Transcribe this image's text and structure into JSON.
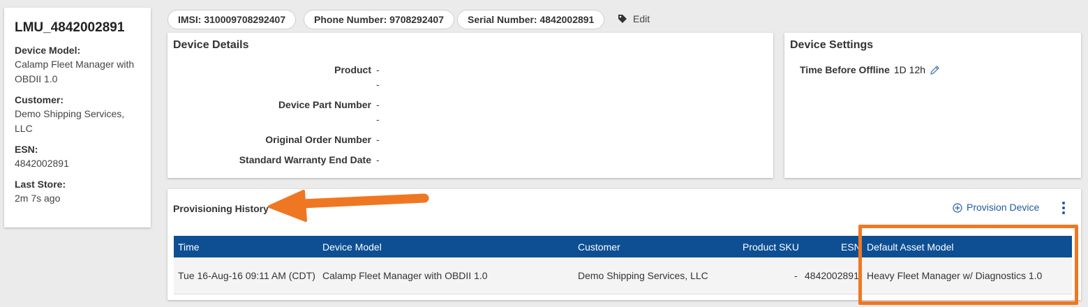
{
  "summary": {
    "title": "LMU_4842002891",
    "fields": [
      {
        "label": "Device Model:",
        "value": "Calamp Fleet Manager with OBDII 1.0"
      },
      {
        "label": "Customer:",
        "value": "Demo Shipping Services, LLC"
      },
      {
        "label": "ESN:",
        "value": "4842002891"
      },
      {
        "label": "Last Store:",
        "value": "2m 7s ago"
      }
    ]
  },
  "chips": {
    "imsi": "IMSI: 310009708292407",
    "phone": "Phone Number: 9708292407",
    "serial": "Serial Number: 4842002891",
    "edit": "Edit"
  },
  "details": {
    "title": "Device Details",
    "rows": [
      {
        "label": "Product",
        "value": "-",
        "value2": "-"
      },
      {
        "label": "Device Part Number",
        "value": "-",
        "value2": "-"
      },
      {
        "label": "Original Order Number",
        "value": "-"
      },
      {
        "label": "Standard Warranty End Date",
        "value": "-"
      }
    ]
  },
  "settings": {
    "title": "Device Settings",
    "offline_label": "Time Before Offline",
    "offline_value": "1D 12h"
  },
  "provisioning": {
    "title": "Provisioning History",
    "button": "Provision Device",
    "columns": [
      "Time",
      "Device Model",
      "Customer",
      "Product SKU",
      "ESN",
      "Default Asset Model"
    ],
    "row": {
      "time": "Tue 16-Aug-16 09:11 AM (CDT)",
      "device_model": "Calamp Fleet Manager with OBDII 1.0",
      "customer": "Demo Shipping Services, LLC",
      "product_sku": "-",
      "esn": "4842002891",
      "default_asset_model": "Heavy Fleet Manager w/ Diagnostics 1.0"
    }
  },
  "colors": {
    "header_bg": "#0e4f93",
    "accent": "#1f5aa0",
    "annotation": "#f07722"
  }
}
